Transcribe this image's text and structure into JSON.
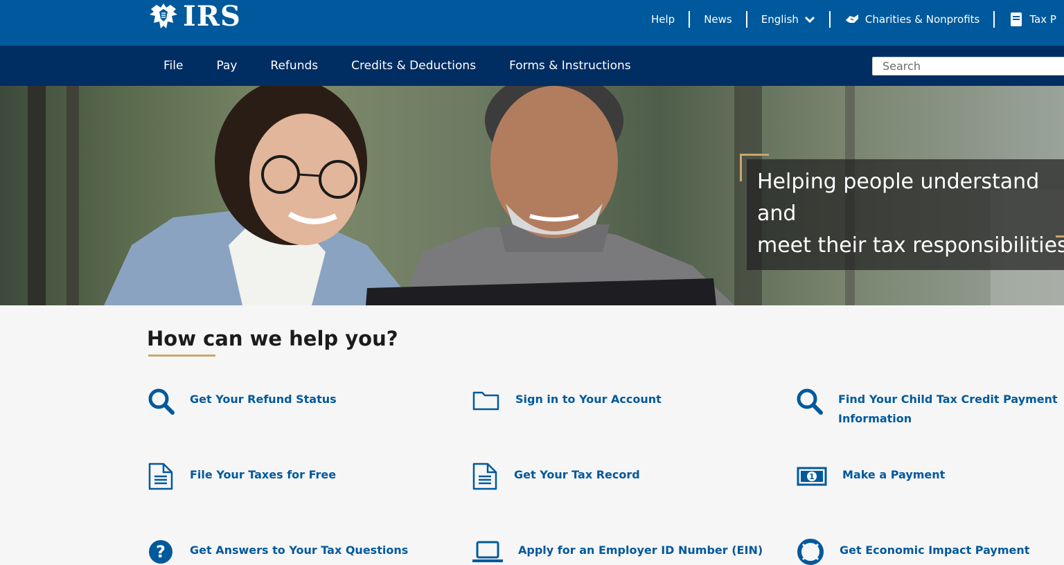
{
  "header": {
    "logo_text": "IRS",
    "utility_links": [
      {
        "label": "Help"
      },
      {
        "label": "News"
      },
      {
        "label": "English"
      },
      {
        "label": "Charities & Nonprofits"
      },
      {
        "label": "Tax P"
      }
    ]
  },
  "nav": {
    "items": [
      {
        "label": "File"
      },
      {
        "label": "Pay"
      },
      {
        "label": "Refunds"
      },
      {
        "label": "Credits & Deductions"
      },
      {
        "label": "Forms & Instructions"
      }
    ],
    "search_placeholder": "Search"
  },
  "hero": {
    "caption_line1": "Helping people understand and",
    "caption_line2": "meet their tax responsibilities"
  },
  "help": {
    "title": "How can we help you?",
    "tiles": [
      {
        "label": "Get Your Refund Status",
        "icon": "search-icon"
      },
      {
        "label": "Sign in to Your Account",
        "icon": "folder-icon"
      },
      {
        "label": "Find Your Child Tax Credit Payment Information",
        "icon": "search-icon"
      },
      {
        "label": "File Your Taxes for Free",
        "icon": "document-icon"
      },
      {
        "label": "Get Your Tax Record",
        "icon": "document-icon"
      },
      {
        "label": "Make a Payment",
        "icon": "money-icon"
      },
      {
        "label": "Get Answers to Your Tax Questions",
        "icon": "question-icon"
      },
      {
        "label": "Apply for an Employer ID Number (EIN)",
        "icon": "laptop-icon"
      },
      {
        "label": "Get Economic Impact Payment",
        "icon": "lifebuoy-icon"
      }
    ]
  },
  "colors": {
    "top_bar": "#00599c",
    "nav_bar": "#002d62",
    "link": "#00599c",
    "accent_gold": "#c9a86a"
  }
}
